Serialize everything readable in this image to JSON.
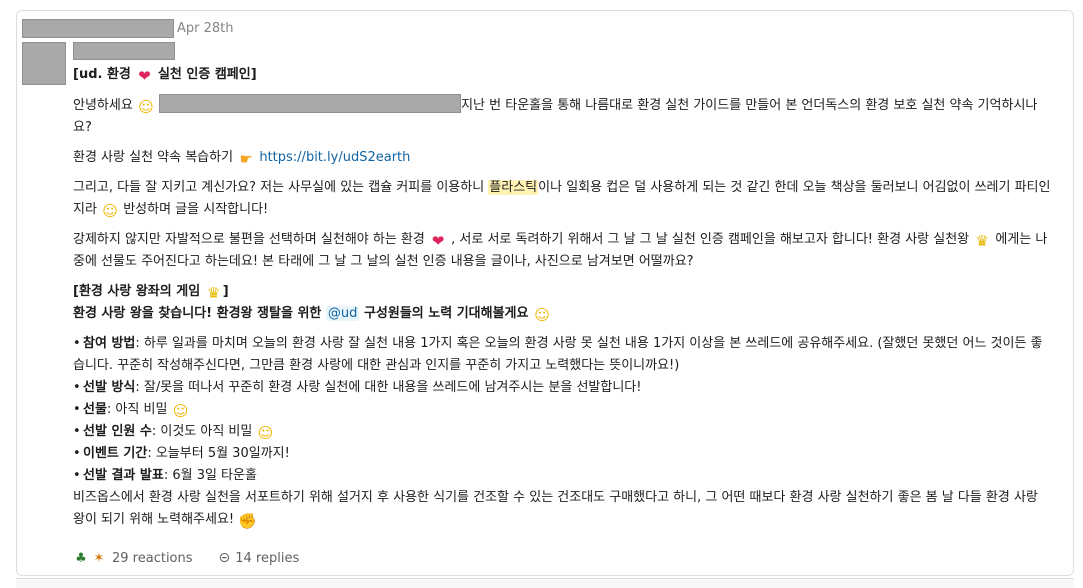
{
  "previous_message": {
    "date": "Apr 28th"
  },
  "message": {
    "title_prefix": "[ud. 환경",
    "title_suffix": "실천 인증 캠페인]",
    "greeting": "안녕하세요",
    "intro_rest": "지난 번 타운홀을 통해 나름대로 환경 실천 가이드를 만들어 본 언더독스의 환경 보호 실천 약속 기억하시나요?",
    "review_text": "환경 사랑 실천 약속 복습하기",
    "review_link": "https://bit.ly/udS2earth",
    "para2_before": "그리고, 다들 잘 지키고 계신가요? 저는 사무실에 있는 캡슐 커피를 이용하니",
    "para2_highlight": "플라스틱",
    "para2_after": "이나 일회용 컵은 덜 사용하게 되는 것 같긴 한데 오늘 책상을 둘러보니 어김없이 쓰레기 파티인지라",
    "para2_end": "반성하며 글을 시작합니다!",
    "para3_before": "강제하지 않지만 자발적으로 불편을 선택하며 실천해야 하는 환경",
    "para3_middle": ", 서로 서로 독려하기 위해서 그 날 그 날 실천 인증 캠페인을 해보고자 합니다! 환경 사랑 실천왕",
    "para3_end": "에게는 나중에 선물도 주어진다고 하는데요! 본 타래에 그 날 그 날의 실천 인증 내용을 글이나, 사진으로 남겨보면 어떨까요?",
    "game_title": "[환경 사랑 왕좌의 게임",
    "game_title_end": "]",
    "cta_before": "환경 사랑 왕을 찾습니다! 환경왕 쟁탈을 위한",
    "cta_mention": "@ud",
    "cta_after": "구성원들의 노력 기대해볼게요",
    "rules": [
      {
        "label": "참여 방법",
        "text": ": 하루 일과를 마치며 오늘의 환경 사랑 잘 실천 내용 1가지 혹은 오늘의 환경 사랑 못 실천 내용 1가지 이상을 본 쓰레드에 공유해주세요. (잘했던 못했던 어느 것이든 좋습니다. 꾸준히 작성해주신다면, 그만큼 환경 사랑에 대한 관심과 인지를 꾸준히 가지고 노력했다는 뜻이니까요!)"
      },
      {
        "label": "선발 방식",
        "text": ": 잘/못을 떠나서 꾸준히 환경 사랑 실천에 대한 내용을 쓰레드에 남겨주시는 분을 선발합니다!"
      },
      {
        "label": "선물",
        "text": ": 아직 비밀"
      },
      {
        "label": "선발 인원 수",
        "text": ": 이것도 아직 비밀"
      },
      {
        "label": "이벤트 기간",
        "text": ":  오늘부터 5월 30일까지!"
      },
      {
        "label": "선발 결과 발표",
        "text": ": 6월 3일 타운홀"
      }
    ],
    "closing": "비즈옵스에서 환경 사랑 실천을 서포트하기 위해 설거지 후 사용한 식기를 건조할 수 있는 건조대도 구매했다고 하니, 그 어떤 때보다 환경 사랑 실천하기 좋은 봄 날 다들 환경 사랑 왕이 되기 위해 노력해주세요!"
  },
  "footer": {
    "reactions_label": "29 reactions",
    "replies_label": "14 replies"
  },
  "icons": {
    "heart": "red-heart-icon",
    "smile": "smiling-face-icon",
    "pointing": "backhand-index-pointing-right-icon",
    "rolling_eyes": "face-with-rolling-eyes-icon",
    "crown": "crown-icon",
    "wink": "winking-face-icon",
    "shush": "shushing-face-icon",
    "flexed": "flexed-biceps-icon",
    "tree": "deciduous-tree-icon",
    "party": "party-popper-icon",
    "thread": "thread-replies-icon"
  },
  "colors": {
    "link": "#1264a3",
    "highlight": "#fff2b3",
    "redaction": "#a9a9a9"
  }
}
